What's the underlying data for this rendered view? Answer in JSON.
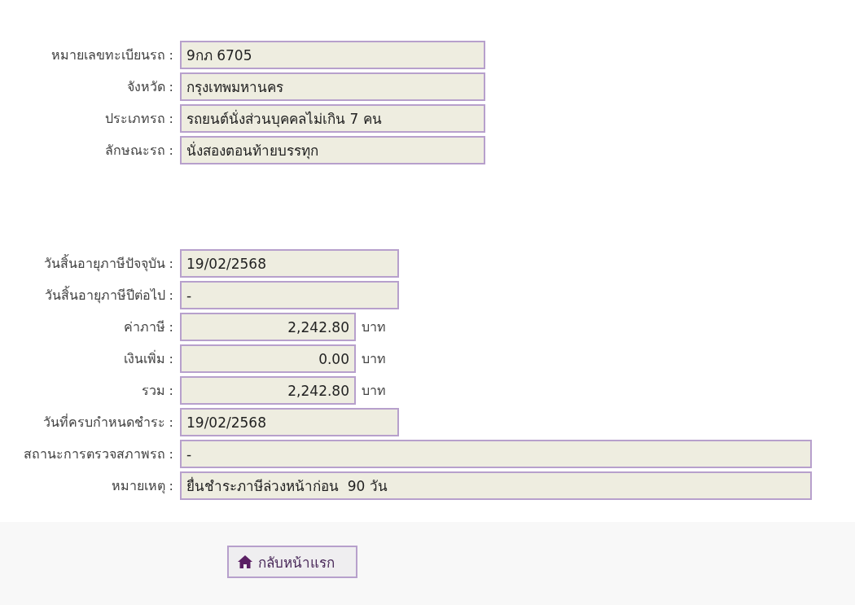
{
  "vehicle": [
    {
      "label": "หมายเลขทะเบียนรถ :",
      "value": "9กภ 6705",
      "kind": "long"
    },
    {
      "label": "จังหวัด :",
      "value": "กรุงเทพมหานคร",
      "kind": "long"
    },
    {
      "label": "ประเภทรถ :",
      "value": "รถยนต์นั่งส่วนบุคคลไม่เกิน 7 คน",
      "kind": "long"
    },
    {
      "label": "ลักษณะรถ :",
      "value": "นั่งสองตอนท้ายบรรทุก",
      "kind": "long"
    }
  ],
  "tax": [
    {
      "label": "วันสิ้นอายุภาษีปัจจุบัน :",
      "value": "19/02/2568",
      "kind": "medium"
    },
    {
      "label": "วันสิ้นอายุภาษีปีต่อไป :",
      "value": "-",
      "kind": "medium"
    },
    {
      "label": "ค่าภาษี :",
      "value": "2,242.80",
      "kind": "amount",
      "unit": "บาท"
    },
    {
      "label": "เงินเพิ่ม :",
      "value": "0.00",
      "kind": "amount",
      "unit": "บาท"
    },
    {
      "label": "รวม :",
      "value": "2,242.80",
      "kind": "amount",
      "unit": "บาท"
    },
    {
      "label": "วันที่ครบกำหนดชำระ :",
      "value": "19/02/2568",
      "kind": "medium"
    },
    {
      "label": "สถานะการตรวจสภาพรถ :",
      "value": "-",
      "kind": "wide"
    },
    {
      "label": "หมายเหตุ :",
      "value": "ยื่นชำระภาษีล่วงหน้าก่อน  90 วัน",
      "kind": "wide"
    }
  ],
  "home_button": {
    "label": "กลับหน้าแรก"
  }
}
